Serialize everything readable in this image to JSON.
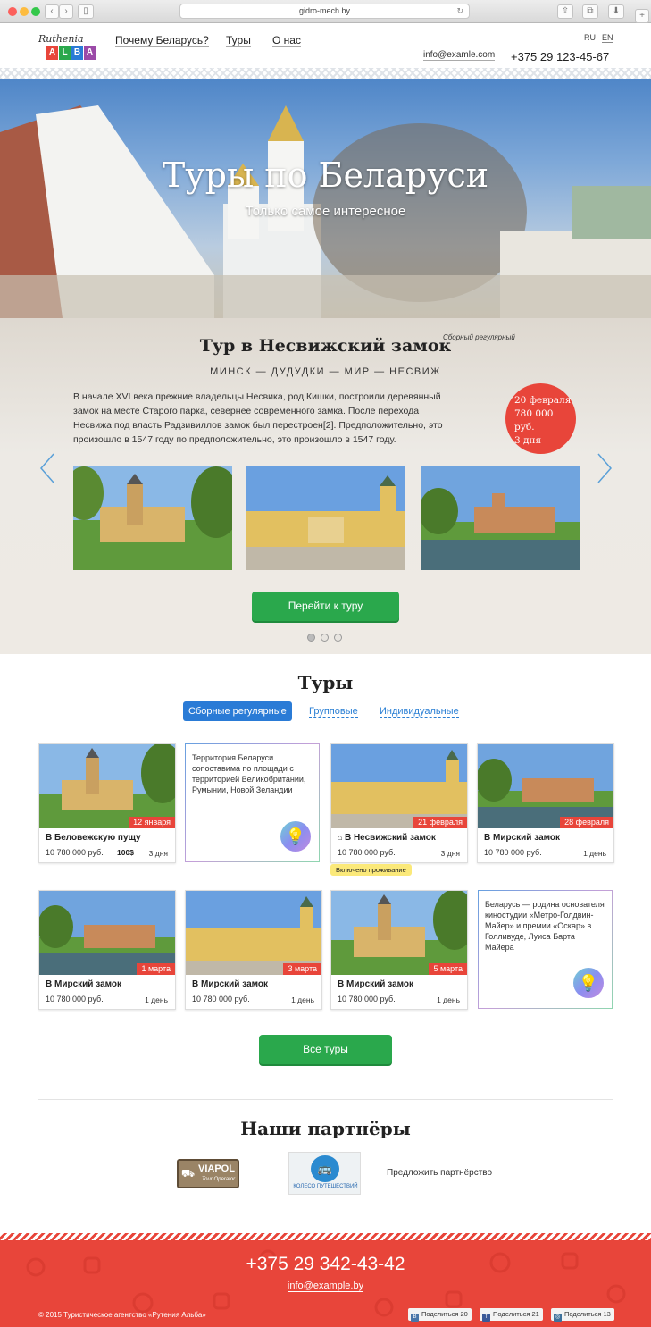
{
  "browser": {
    "url": "gidro-mech.by"
  },
  "header": {
    "logo_top": "Ruthenia",
    "logo_letters": [
      "A",
      "L",
      "B",
      "A"
    ],
    "logo_colors": [
      "#e8453a",
      "#2aa84c",
      "#2a7bd6",
      "#9b4aa8"
    ],
    "nav": [
      "Почему Беларусь?",
      "Туры",
      "О нас"
    ],
    "lang_ru": "RU",
    "lang_en": "EN",
    "email": "info@examle.com",
    "phone": "+375 29 123-45-67"
  },
  "hero": {
    "title": "Туры по Беларуси",
    "subtitle": "Только самое интересное"
  },
  "featured": {
    "title": "Тур в Несвижский замок",
    "tag": "Сборный регулярный",
    "route": "МИНСК — ДУДУДКИ — МИР — НЕСВИЖ",
    "description": "В начале XVI века прежние владельцы Несвика, род Кишки, построили деревянный замок на месте Старого парка, севернее современного замка. После перехода Несвижа под власть Радзивиллов замок был перестроен[2]. Предположительно, это произошло в 1547 году по предположительно, это произошло в 1547 году.",
    "badge_date": "20 февраля",
    "badge_price": "780 000 руб.",
    "badge_days": "3 дня",
    "cta": "Перейти к туру"
  },
  "tours": {
    "heading": "Туры",
    "tabs": [
      "Сборные регулярные",
      "Групповые",
      "Индивидуальные"
    ],
    "cards": [
      {
        "title": "В Беловежскую пущу",
        "price": "10 780 000 руб.",
        "extra": "100$",
        "days": "3 дня",
        "date": "12 января"
      },
      {
        "title": "В Несвижский замок",
        "price": "10 780 000 руб.",
        "days": "3 дня",
        "date": "21 февраля",
        "note": "Включено проживание"
      },
      {
        "title": "В Мирский замок",
        "price": "10 780 000 руб.",
        "days": "1 день",
        "date": "28 февраля"
      },
      {
        "title": "В Мирский замок",
        "price": "10 780 000 руб.",
        "days": "1 день",
        "date": "1 марта"
      },
      {
        "title": "В Мирский замок",
        "price": "10 780 000 руб.",
        "days": "1 день",
        "date": "3 марта"
      },
      {
        "title": "В Мирский замок",
        "price": "10 780 000 руб.",
        "days": "1 день",
        "date": "5 марта"
      }
    ],
    "fact1": "Территория Беларуси сопоставима по площади с территорией Великобритании, Румынии, Новой Зеландии",
    "fact2": "Беларусь — родина основателя киностудии «Метро-Голдвин-Майер» и премии «Оскар» в Голливуде, Луиса Барта Майера",
    "all_button": "Все туры"
  },
  "partners": {
    "heading": "Наши партнёры",
    "logo1_main": "VIAPOL",
    "logo1_sub": "Tour Operator",
    "logo2": "КОЛЕСО ПУТЕШЕСТВИЙ",
    "offer": "Предложить партнёрство"
  },
  "footer": {
    "phone": "+375 29 342-43-42",
    "email": "info@example.by",
    "copyright": "© 2015 Туристическое агентство «Рутения Альба»",
    "shares": [
      {
        "label": "Поделиться",
        "count": "20",
        "color": "#4a76a8",
        "icon": "vk-icon"
      },
      {
        "label": "Поделиться",
        "count": "21",
        "color": "#3b5998",
        "icon": "facebook-icon"
      },
      {
        "label": "Поделиться",
        "count": "13",
        "color": "#3f729b",
        "icon": "instagram-icon"
      }
    ]
  }
}
